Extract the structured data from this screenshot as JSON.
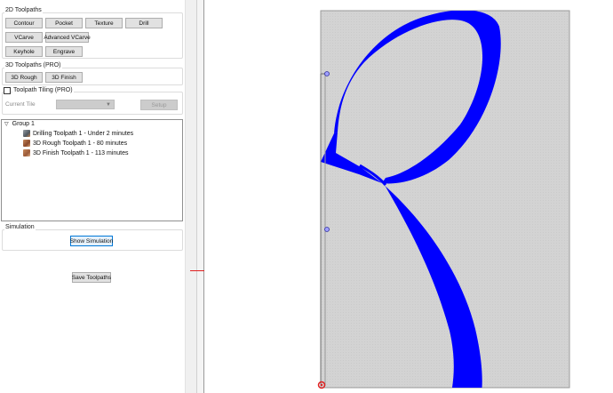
{
  "toolpaths_2d": {
    "title": "2D Toolpaths",
    "buttons": [
      "Contour",
      "Pocket",
      "Texture",
      "Drill",
      "VCarve",
      "Advanced VCarve",
      "Keyhole",
      "Engrave"
    ]
  },
  "toolpaths_3d": {
    "title": "3D Toolpaths (PRO)",
    "buttons": [
      "3D Rough",
      "3D Finish"
    ]
  },
  "tiling": {
    "checkbox_label": "Toolpath Tiling (PRO)",
    "checked": false,
    "current_tile_label": "Current Tile",
    "current_tile_value": "",
    "setup_label": "Setup"
  },
  "tree": {
    "group_label": "Group 1",
    "items": [
      {
        "label": "Drilling Toolpath 1 - Under 2 minutes",
        "icon": "drill-toolpath-icon"
      },
      {
        "label": "3D Rough Toolpath 1 - 80 minutes",
        "icon": "rough-toolpath-icon"
      },
      {
        "label": "3D Finish Toolpath 1 - 113 minutes",
        "icon": "finish-toolpath-icon"
      }
    ]
  },
  "simulation": {
    "title": "Simulation",
    "show_label": "Show Simulation"
  },
  "save_label": "Save Toolpaths",
  "colors": {
    "shape_fill": "#0000ff",
    "stock_fill": "#d3d3d3",
    "accent": "#0078d7",
    "marker": "#e02020"
  }
}
